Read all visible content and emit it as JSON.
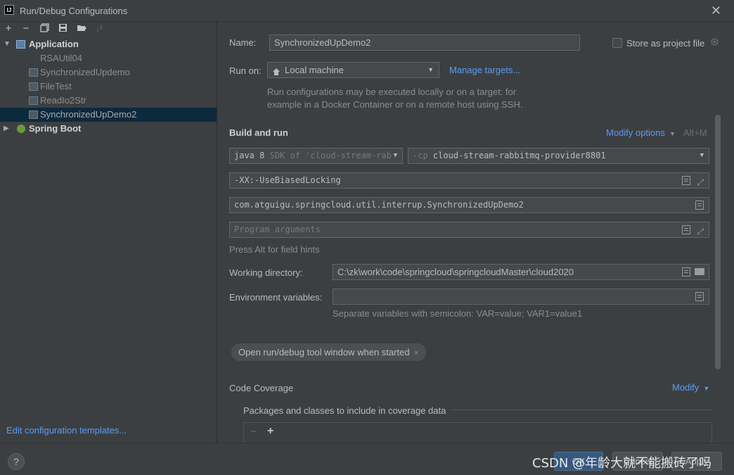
{
  "window": {
    "app_icon": "IJ",
    "title": "Run/Debug Configurations",
    "close": "✕"
  },
  "toolbar": {
    "icons": [
      "add-icon",
      "remove-icon",
      "copy-icon",
      "save-icon",
      "move-to-folder-icon",
      "sort-icon"
    ]
  },
  "tree": {
    "application": {
      "label": "Application",
      "arrow": "▼"
    },
    "children": [
      {
        "label": "RSAUtil04"
      },
      {
        "label": "SynchronizedUpdemo"
      },
      {
        "label": "FileTest"
      },
      {
        "label": "ReadIo2Str"
      },
      {
        "label": "SynchronizedUpDemo2"
      }
    ],
    "spring_boot": {
      "label": "Spring Boot",
      "arrow": "▶"
    }
  },
  "left_footer": {
    "edit_templates": "Edit configuration templates..."
  },
  "form": {
    "name_label": "Name:",
    "name_value": "SynchronizedUpDemo2",
    "store_label": "Store as project file",
    "run_on_label": "Run on:",
    "run_on_value": "Local machine",
    "manage_targets": "Manage targets...",
    "run_on_hint_1": "Run configurations may be executed locally or on a target: for",
    "run_on_hint_2": "example in a Docker Container or on a remote host using SSH.",
    "build_run_title": "Build and run",
    "modify_options": "Modify options",
    "modify_options_shortcut": "Alt+M",
    "sdk_value": "java 8",
    "sdk_hint": "SDK of 'cloud-stream-rab",
    "cp_prefix": "-cp",
    "cp_value": "cloud-stream-rabbitmq-provider8801",
    "vm_options": "-XX:-UseBiasedLocking",
    "main_class": "com.atguigu.springcloud.util.interrup.SynchronizedUpDemo2",
    "program_args_placeholder": "Program arguments",
    "alt_hint": "Press Alt for field hints",
    "working_dir_label": "Working directory:",
    "working_dir_value": "C:\\zk\\work\\code\\springcloud\\springcloudMaster\\cloud2020",
    "env_label": "Environment variables:",
    "env_value": "",
    "env_hint": "Separate variables with semicolon: VAR=value; VAR1=value1",
    "chip_label": "Open run/debug tool window when started",
    "chip_close": "×",
    "code_coverage_title": "Code Coverage",
    "modify": "Modify",
    "packages_label": "Packages and classes to include in coverage data"
  },
  "bottom": {
    "help": "?",
    "ok": "OK",
    "cancel": "Cancel",
    "apply": "Apply",
    "watermark": "CSDN @年龄大就不能搬砖了吗"
  }
}
